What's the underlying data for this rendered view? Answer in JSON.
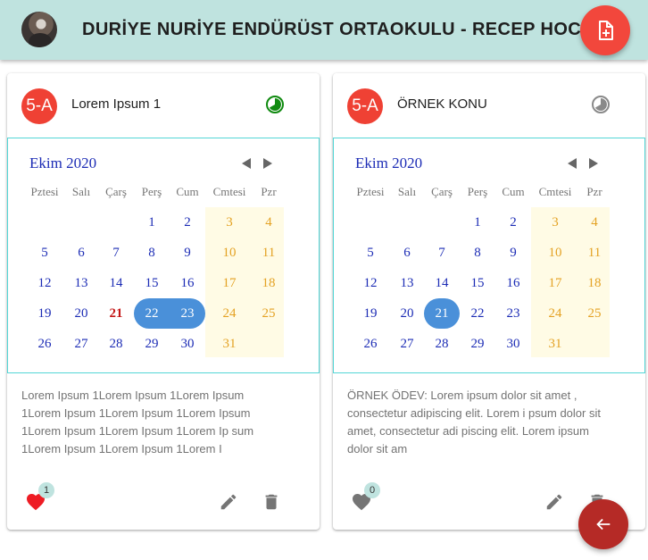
{
  "app": {
    "title": "DURİYE NURİYE ENDÜRÜST ORTAOKULU - RECEP HOCA"
  },
  "icons": {
    "add": "note-add-icon",
    "back": "arrow-left-icon",
    "like": "heart-icon",
    "edit": "pencil-icon",
    "delete": "trash-icon",
    "status": "pie-clock-icon"
  },
  "colors": {
    "appbar": "#bfe3df",
    "accent": "#f2473c",
    "selected": "#4a90d9",
    "weekend": "#e4a224",
    "weekday": "#1c2cb5",
    "liked": "#ee1c24"
  },
  "weekdays": [
    "Pztesi",
    "Salı",
    "Çarş",
    "Perş",
    "Cum",
    "Cmtesi",
    "Pzr"
  ],
  "cards": [
    {
      "class": "5-A",
      "title": "Lorem Ipsum 1",
      "month": "Ekim 2020",
      "status_color": "#108a10",
      "text": "Lorem Ipsum 1Lorem Ipsum 1Lorem Ipsum 1Lorem Ipsum 1Lorem Ipsum 1Lorem Ipsum 1Lorem Ipsum 1Lorem Ipsum 1Lorem Ip sum 1Lorem Ipsum 1Lorem Ipsum 1Lorem I",
      "likes": "1",
      "liked": true,
      "weeks": [
        [
          "",
          "",
          "",
          "1",
          "2",
          "3",
          "4"
        ],
        [
          "5",
          "6",
          "7",
          "8",
          "9",
          "10",
          "11"
        ],
        [
          "12",
          "13",
          "14",
          "15",
          "16",
          "17",
          "18"
        ],
        [
          "19",
          "20",
          "21",
          "22",
          "23",
          "24",
          "25"
        ],
        [
          "26",
          "27",
          "28",
          "29",
          "30",
          "31",
          ""
        ]
      ],
      "today": "21",
      "selected": [
        "22",
        "23"
      ]
    },
    {
      "class": "5-A",
      "title": "ÖRNEK KONU",
      "month": "Ekim 2020",
      "status_color": "#8a8a8a",
      "text": "ÖRNEK ÖDEV: Lorem ipsum dolor sit amet , consectetur adipiscing elit. Lorem i psum dolor sit amet, consectetur adi piscing elit. Lorem ipsum dolor sit am",
      "likes": "0",
      "liked": false,
      "weeks": [
        [
          "",
          "",
          "",
          "1",
          "2",
          "3",
          "4"
        ],
        [
          "5",
          "6",
          "7",
          "8",
          "9",
          "10",
          "11"
        ],
        [
          "12",
          "13",
          "14",
          "15",
          "16",
          "17",
          "18"
        ],
        [
          "19",
          "20",
          "21",
          "22",
          "23",
          "24",
          "25"
        ],
        [
          "26",
          "27",
          "28",
          "29",
          "30",
          "31",
          ""
        ]
      ],
      "today": "",
      "selected": [
        "21"
      ]
    }
  ]
}
